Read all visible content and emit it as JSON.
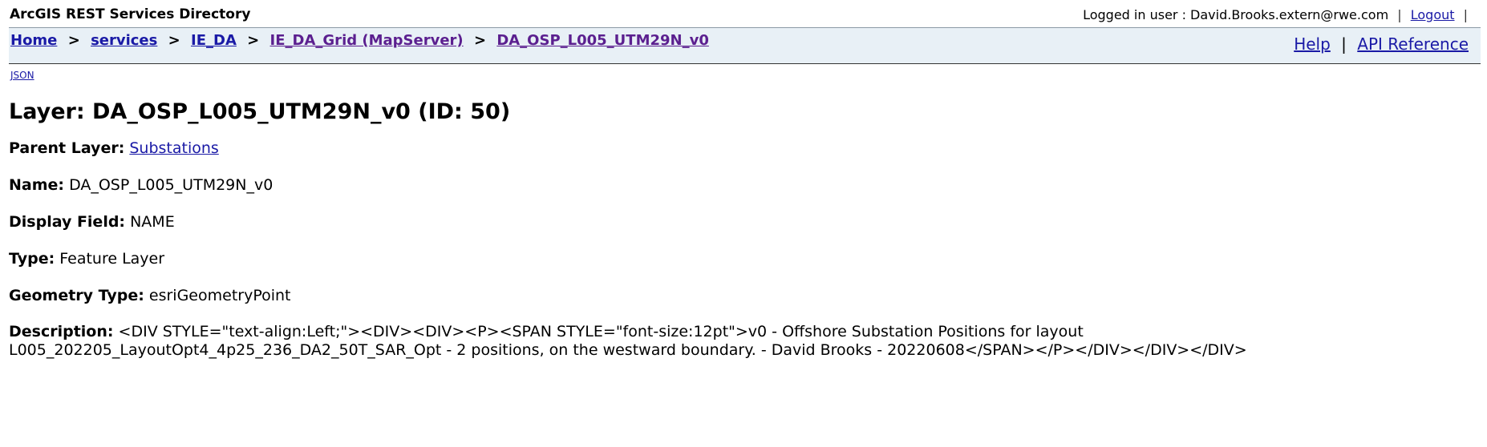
{
  "app_title": "ArcGIS REST Services Directory",
  "login": {
    "prefix": "Logged in user : David.Brooks.extern@rwe.com",
    "sep1": "|",
    "logout": "Logout",
    "sep2": "|"
  },
  "breadcrumb": {
    "home": "Home",
    "services": "services",
    "folder": "IE_DA",
    "mapserver": "IE_DA_Grid (MapServer)",
    "layer": "DA_OSP_L005_UTM29N_v0",
    "separator": ">"
  },
  "help_links": {
    "help": "Help",
    "sep": "|",
    "api": "API Reference"
  },
  "json_link": "JSON",
  "layer_title": "Layer: DA_OSP_L005_UTM29N_v0 (ID: 50)",
  "properties": {
    "parent_layer": {
      "label": "Parent Layer:",
      "value": "Substations"
    },
    "name": {
      "label": "Name:",
      "value": "DA_OSP_L005_UTM29N_v0"
    },
    "display_field": {
      "label": "Display Field:",
      "value": "NAME"
    },
    "type": {
      "label": "Type:",
      "value": "Feature Layer"
    },
    "geometry_type": {
      "label": "Geometry Type:",
      "value": "esriGeometryPoint"
    },
    "description": {
      "label": "Description:",
      "value": "<DIV STYLE=\"text-align:Left;\"><DIV><DIV><P><SPAN STYLE=\"font-size:12pt\">v0 - Offshore Substation Positions for layout L005_202205_LayoutOpt4_4p25_236_DA2_50T_SAR_Opt - 2 positions, on the westward boundary. - David Brooks - 20220608</SPAN></P></DIV></DIV></DIV>"
    }
  },
  "colors": {
    "link": "#1a1aa6",
    "visited_link": "#5b1f8f",
    "nav_background": "#e8f0f6"
  }
}
